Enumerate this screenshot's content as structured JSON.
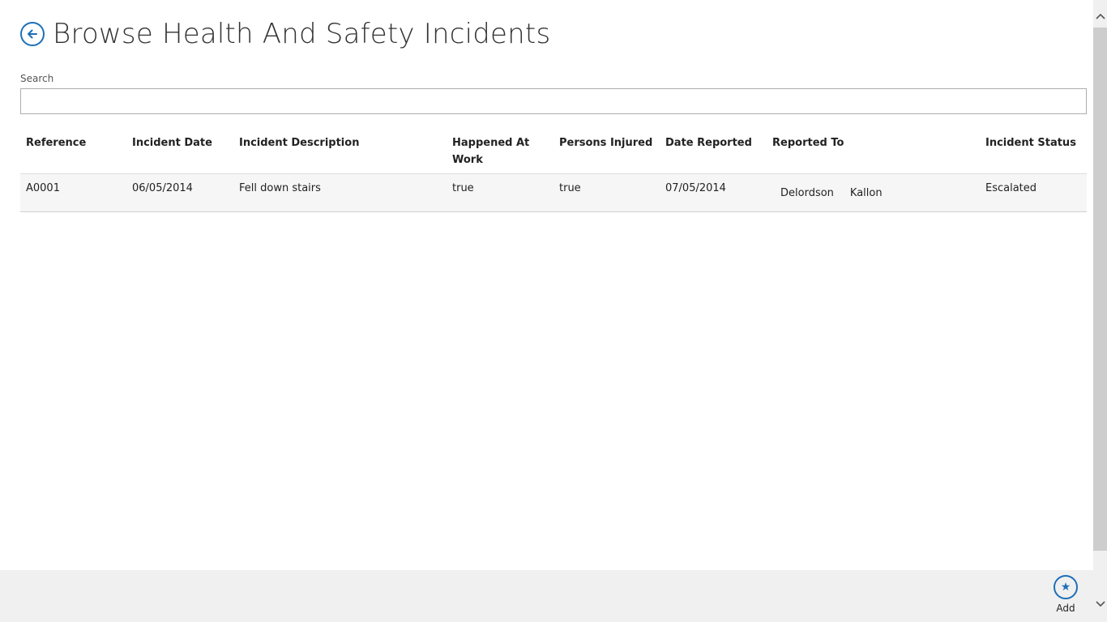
{
  "header": {
    "title": "Browse Health And Safety Incidents",
    "back_icon": "arrow-left-icon"
  },
  "search": {
    "label": "Search",
    "value": "",
    "placeholder": ""
  },
  "table": {
    "columns": [
      "Reference",
      "Incident Date",
      "Incident Description",
      "Happened At Work",
      "Persons Injured",
      "Date Reported",
      "Reported To",
      "Incident Status"
    ],
    "rows": [
      {
        "reference": "A0001",
        "incident_date": "06/05/2014",
        "incident_description": "Fell down stairs",
        "happened_at_work": "true",
        "persons_injured": "true",
        "date_reported": "07/05/2014",
        "reported_to_first": "Delordson",
        "reported_to_last": "Kallon",
        "incident_status": "Escalated"
      }
    ]
  },
  "appbar": {
    "add_label": "Add",
    "add_icon": "star-icon"
  },
  "colors": {
    "accent": "#1e6fb8",
    "appbar_bg": "#f0f0f0",
    "row_bg": "#f6f6f6"
  }
}
